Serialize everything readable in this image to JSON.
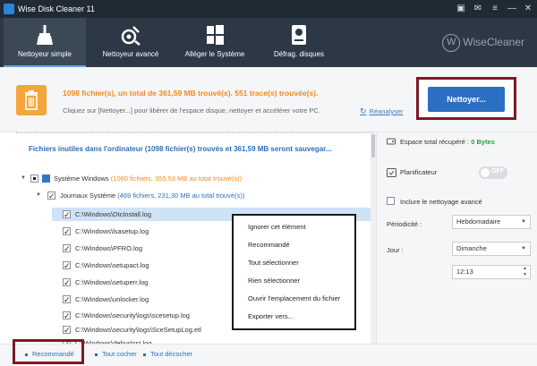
{
  "window": {
    "title": "Wise Disk Cleaner 11",
    "controls": [
      "▣",
      "✉",
      "≡",
      "—",
      "✕"
    ]
  },
  "nav": {
    "tabs": [
      {
        "label": "Nettoyeur simple",
        "icon": "broom-icon",
        "active": true
      },
      {
        "label": "Nettoyeur avancé",
        "icon": "advanced-cleaner-icon",
        "active": false
      },
      {
        "label": "Alléger le Système",
        "icon": "windows-icon",
        "active": false
      },
      {
        "label": "Défrag. disques",
        "icon": "disk-defrag-icon",
        "active": false
      }
    ],
    "brand_letter": "W",
    "brand": "WiseCleaner"
  },
  "summary": {
    "main": "1098 fichier(s), un total de 361,59 MB trouvé(s). 551 trace(s) trouvée(s).",
    "sub": "Cliquez sur [Nettoyer...] pour libérer de l'espace disque, nettoyer et accélérer votre PC.",
    "reanalyse": "Réanalyser",
    "clean_button": "Nettoyer..."
  },
  "list": {
    "header": "Fichiers inutiles dans l'ordinateur (1098 fichier(s) trouvés et 361,59 MB seront sauvegar...",
    "group": {
      "name": "Système Windows",
      "info": "(1060 fichiers, 355,53 MB au total trouvé(s))"
    },
    "subgroup": {
      "name": "Journaux Système",
      "info": "(469 fichiers, 231,30 MB au total trouvé(s))"
    },
    "files": [
      "C:\\Windows\\DtcInstall.log",
      "C:\\Windows\\lsasetup.log",
      "C:\\Windows\\PFRO.log",
      "C:\\Windows\\setupact.log",
      "C:\\Windows\\setuperr.log",
      "C:\\Windows\\unlocker.log",
      "C:\\Windows\\security\\logs\\scesetup.log",
      "C:\\Windows\\security\\logs\\SceSetupLog.etl",
      "C:\\Windows\\debug\\rst.log"
    ]
  },
  "context_menu": {
    "items": [
      "Ignorer cet élément",
      "Recommandé",
      "Tout sélectionner",
      "Rien sélectionner",
      "Ouvrir l'emplacement du fichier",
      "Exporter vers..."
    ]
  },
  "right_panel": {
    "space_label": "Espace total récupéré :",
    "space_value": "0 Bytes",
    "scheduler_label": "Planificateur",
    "toggle_state": "OFF",
    "include_advanced": "Inclure le nettoyage avancé",
    "periodicity_label": "Périodicité :",
    "periodicity_value": "Hebdomadaire",
    "day_label": "Jour :",
    "day_value": "Dimanche",
    "time_value": "12:13"
  },
  "footer": {
    "recommended": "Recommandé",
    "check_all": "Tout cocher",
    "uncheck_all": "Tout décocher"
  },
  "colors": {
    "titlebar": "#202a35",
    "navbar": "#2c3845",
    "accent_orange": "#f28a1c",
    "accent_blue": "#2b6fc3",
    "highlight_frame": "#7b1a26",
    "green": "#2e9a3f"
  }
}
